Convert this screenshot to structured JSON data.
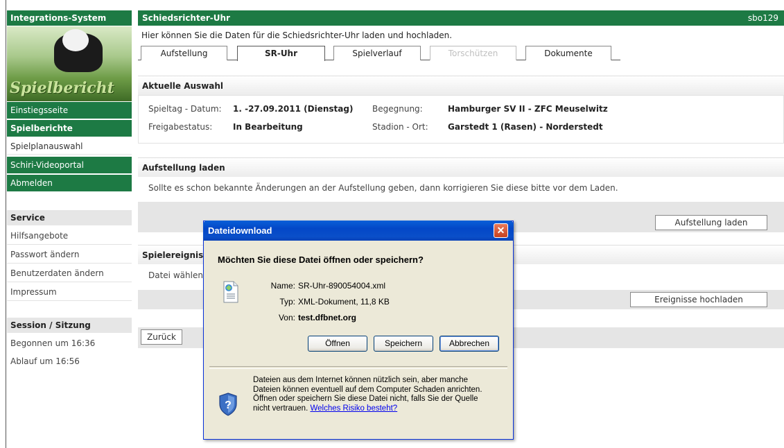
{
  "sidebar": {
    "system_title": "Integrations-System",
    "banner_text": "Spielbericht",
    "nav": [
      {
        "label": "Einstiegsseite"
      },
      {
        "label": "Spielberichte"
      },
      {
        "label": "Spielplanauswahl"
      },
      {
        "label": "Schiri-Videoportal"
      },
      {
        "label": "Abmelden"
      }
    ],
    "service": {
      "title": "Service",
      "items": [
        "Hilfsangebote",
        "Passwort ändern",
        "Benutzerdaten ändern",
        "Impressum"
      ]
    },
    "session": {
      "title": "Session / Sitzung",
      "started": "Begonnen um 16:36",
      "expires": "Ablauf um 16:56"
    }
  },
  "header": {
    "title": "Schiedsrichter-Uhr",
    "user": "sbo129",
    "intro": "Hier können Sie die Daten für die Schiedsrichter-Uhr laden und hochladen."
  },
  "tabs": [
    {
      "label": "Aufstellung"
    },
    {
      "label": "SR-Uhr"
    },
    {
      "label": "Spielverlauf"
    },
    {
      "label": "Torschützen"
    },
    {
      "label": "Dokumente"
    }
  ],
  "selection": {
    "title": "Aktuelle Auswahl",
    "matchday_label": "Spieltag - Datum:",
    "matchday_value": "1. -27.09.2011 (Dienstag)",
    "status_label": "Freigabestatus:",
    "status_value": "In Bearbeitung",
    "match_label": "Begegnung:",
    "match_value": "Hamburger SV II - ZFC Meuselwitz",
    "stadium_label": "Stadion - Ort:",
    "stadium_value": "Garstedt 1 (Rasen) - Norderstedt"
  },
  "lineup": {
    "title": "Aufstellung laden",
    "text": "Sollte es schon bekannte Änderungen an der Aufstellung geben, dann korrigieren Sie diese bitte vor dem Laden.",
    "button": "Aufstellung laden"
  },
  "events": {
    "title": "Spielereignis",
    "file_label": "Datei wählen",
    "button": "Ereignisse hochladen"
  },
  "back_button": "Zurück",
  "dialog": {
    "title": "Dateidownload",
    "close": "✕",
    "question": "Möchten Sie diese Datei öffnen oder speichern?",
    "name_label": "Name:",
    "name_value": "SR-Uhr-890054004.xml",
    "type_label": "Typ:",
    "type_value": "XML-Dokument, 11,8 KB",
    "from_label": "Von:",
    "from_value": "test.dfbnet.org",
    "btn_open": "Öffnen",
    "btn_save": "Speichern",
    "btn_cancel": "Abbrechen",
    "note_line1": "Dateien aus dem Internet können nützlich sein, aber manche",
    "note_line2": "Dateien können eventuell auf dem Computer Schaden anrichten.",
    "note_line3": "Öffnen oder speichern Sie diese Datei nicht, falls Sie der Quelle",
    "note_line4": "nicht vertrauen.",
    "note_link": "Welches Risiko besteht?"
  }
}
